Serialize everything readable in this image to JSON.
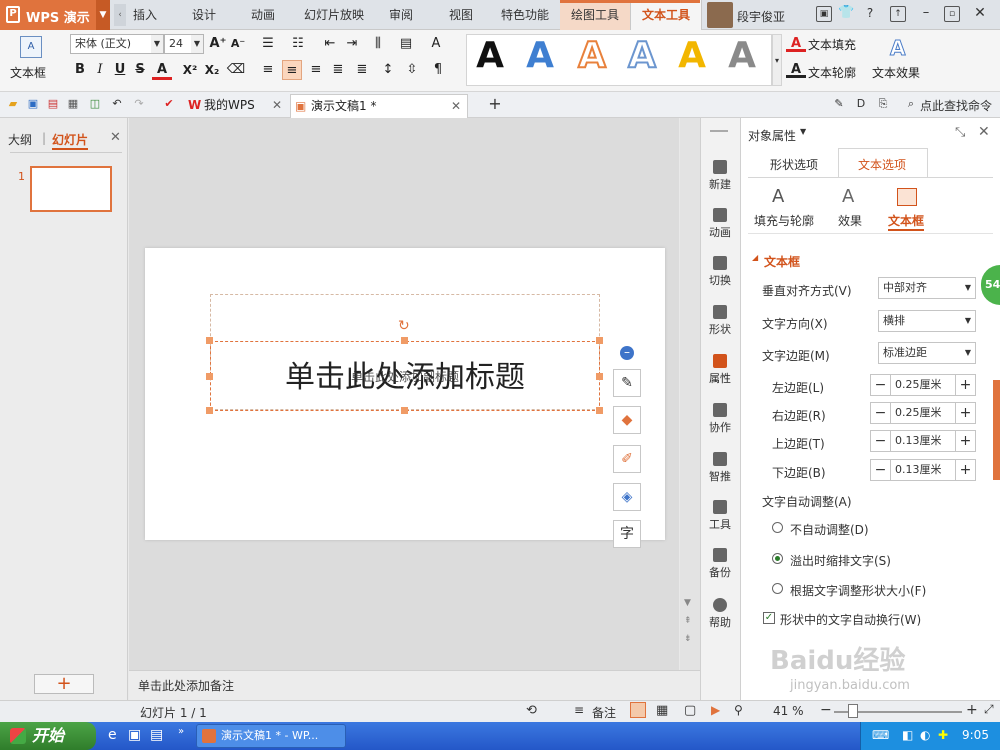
{
  "app": {
    "logo": "WPS 演示",
    "logo_glyph": "P"
  },
  "ribbon_tabs": [
    "插入",
    "设计",
    "动画",
    "幻灯片放映",
    "审阅",
    "视图",
    "特色功能",
    "绘图工具",
    "文本工具"
  ],
  "user": {
    "name": "段宇俊亚"
  },
  "ribbon": {
    "textbox_label": "文本框",
    "font_name": "宋体 (正文)",
    "font_size": "24",
    "bold": "B",
    "italic": "I",
    "underline": "U",
    "strike": "S",
    "font_color": "A",
    "superscript": "X²",
    "subscript": "X₂",
    "grow": "A⁺",
    "shrink": "A⁻",
    "fill_label": "文本填充",
    "outline_label": "文本轮廓",
    "effect_label": "文本效果",
    "styles": [
      "A",
      "A",
      "A",
      "A",
      "A",
      "A"
    ]
  },
  "quickbar": {
    "tab_home": "我的WPS",
    "tab_doc": "演示文稿1 *",
    "search": "点此查找命令"
  },
  "left_panel": {
    "tab_outline": "大纲",
    "tab_slides": "幻灯片",
    "slide_number": "1"
  },
  "slide": {
    "title_placeholder": "单击此处添加标题",
    "overlay_text": "单击此处添加副标题"
  },
  "notes": {
    "placeholder": "单击此处添加备注"
  },
  "sidebar": [
    "新建",
    "动画",
    "切换",
    "形状",
    "属性",
    "协作",
    "智推",
    "工具",
    "备份",
    "帮助"
  ],
  "prop": {
    "title": "对象属性",
    "tab_shape": "形状选项",
    "tab_text": "文本选项",
    "sub_fill": "填充与轮廓",
    "sub_effect": "效果",
    "sub_textbox": "文本框",
    "section": "文本框",
    "valign_label": "垂直对齐方式(V)",
    "valign_value": "中部对齐",
    "dir_label": "文字方向(X)",
    "dir_value": "横排",
    "margin_label": "文字边距(M)",
    "margin_value": "标准边距",
    "left_label": "左边距(L)",
    "left_value": "0.25厘米",
    "right_label": "右边距(R)",
    "right_value": "0.25厘米",
    "top_label": "上边距(T)",
    "top_value": "0.13厘米",
    "bottom_label": "下边距(B)",
    "bottom_value": "0.13厘米",
    "auto_label": "文字自动调整(A)",
    "opt_none": "不自动调整(D)",
    "opt_shrink": "溢出时缩排文字(S)",
    "opt_resize": "根据文字调整形状大小(F)",
    "wrap_label": "形状中的文字自动换行(W)",
    "badge": "54"
  },
  "status": {
    "slide_info": "幻灯片 1 / 1",
    "notes_btn": "备注",
    "zoom": "41 %"
  },
  "taskbar": {
    "start": "开始",
    "item": "演示文稿1 * - WP...",
    "time": "9:05"
  },
  "watermark": {
    "brand": "Baidu经验",
    "url": "jingyan.baidu.com"
  },
  "colors": {
    "accent": "#e0733d",
    "active_text": "#d2531b"
  }
}
